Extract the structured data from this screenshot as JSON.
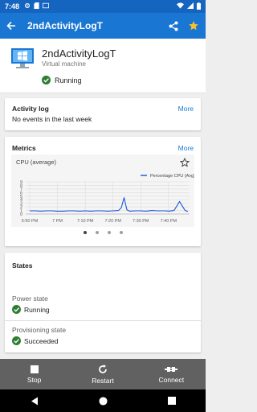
{
  "status_bar": {
    "time": "7:48"
  },
  "app_bar": {
    "title": "2ndActivityLogT"
  },
  "vm": {
    "name": "2ndActivityLogT",
    "type": "Virtual machine",
    "status": "Running"
  },
  "activity_log": {
    "title": "Activity log",
    "more_label": "More",
    "message": "No events in the last week"
  },
  "metrics": {
    "title": "Metrics",
    "more_label": "More"
  },
  "chart_data": {
    "type": "line",
    "title": "CPU (average)",
    "series": [
      {
        "name": "Percentage CPU (Avg)",
        "color": "#1a56db",
        "x": [
          "6:50 PM",
          "6:52 PM",
          "6:54 PM",
          "6:56 PM",
          "6:58 PM",
          "7:00 PM",
          "7:02 PM",
          "7:04 PM",
          "7:06 PM",
          "7:08 PM",
          "7:10 PM",
          "7:12 PM",
          "7:14 PM",
          "7:16 PM",
          "7:18 PM",
          "7:20 PM",
          "7:22 PM",
          "7:23 PM",
          "7:24 PM",
          "7:25 PM",
          "7:26 PM",
          "7:28 PM",
          "7:30 PM",
          "7:32 PM",
          "7:34 PM",
          "7:36 PM",
          "7:37 PM",
          "7:38 PM",
          "7:39 PM",
          "7:40 PM",
          "7:42 PM",
          "7:44 PM",
          "7:45 PM",
          "7:46 PM",
          "7:47 PM"
        ],
        "values": [
          0.9,
          0.9,
          0.8,
          0.9,
          0.9,
          0.8,
          0.8,
          0.9,
          0.9,
          0.8,
          0.9,
          0.8,
          0.9,
          0.9,
          0.8,
          0.9,
          1.0,
          1.8,
          4.6,
          1.2,
          0.8,
          0.9,
          0.9,
          0.8,
          1.0,
          0.9,
          0.9,
          0.9,
          0.9,
          0.8,
          1.0,
          3.5,
          2.2,
          1.0,
          0.7
        ]
      }
    ],
    "x_ticks": [
      "6:50 PM",
      "7 PM",
      "7:10 PM",
      "7:20 PM",
      "7:30 PM",
      "7:40 PM"
    ],
    "ylim": [
      0,
      9
    ],
    "y_ticks": [
      0,
      1,
      2,
      3,
      4,
      5,
      6,
      7,
      8,
      9
    ],
    "grid": true,
    "legend": "top-right"
  },
  "states": {
    "title": "States",
    "power_state_label": "Power state",
    "power_state_value": "Running",
    "provisioning_state_label": "Provisioning state",
    "provisioning_state_value": "Succeeded"
  },
  "bottom_bar": {
    "stop_label": "Stop",
    "restart_label": "Restart",
    "connect_label": "Connect"
  },
  "colors": {
    "primary": "#1976d2",
    "success": "#2e7d32",
    "star": "#fbc02d"
  }
}
